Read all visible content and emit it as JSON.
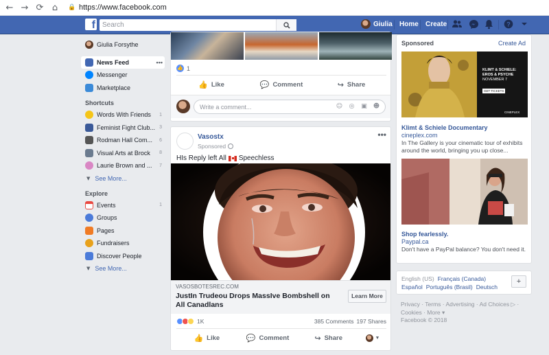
{
  "browser": {
    "back": "←",
    "forward": "→",
    "reload": "⟳",
    "home": "⌂",
    "url": "https://www.facebook.com"
  },
  "topbar": {
    "logo": "f",
    "search_placeholder": "Search",
    "user_name": "Giulia",
    "home": "Home",
    "create": "Create",
    "brand_color": "#4267b2"
  },
  "left_nav": {
    "profile": "Giulia Forsythe",
    "main": [
      {
        "label": "News Feed",
        "icon": "news-feed-icon",
        "color": "#4267b2"
      },
      {
        "label": "Messenger",
        "icon": "messenger-icon",
        "color": "#0084ff"
      },
      {
        "label": "Marketplace",
        "icon": "marketplace-icon",
        "color": "#3b8ad8"
      }
    ],
    "more": "•••",
    "shortcuts_head": "Shortcuts",
    "shortcuts": [
      {
        "label": "Words With Friends",
        "count": "1",
        "color": "#f5c518"
      },
      {
        "label": "Feminist Fight Club...",
        "count": "3",
        "color": "#3a5998"
      },
      {
        "label": "Rodman Hall Com...",
        "count": "6",
        "color": "#555555"
      },
      {
        "label": "Visual Arts at Brock",
        "count": "8",
        "color": "#6b7b8f"
      },
      {
        "label": "Laurie Brown and ...",
        "count": "7",
        "color": "#d987c4"
      }
    ],
    "see_more": "See More...",
    "explore_head": "Explore",
    "explore": [
      {
        "label": "Events",
        "count": "1",
        "color": "#e9473f"
      },
      {
        "label": "Groups",
        "count": "",
        "color": "#4b7bd9"
      },
      {
        "label": "Pages",
        "count": "",
        "color": "#f07b24"
      },
      {
        "label": "Fundraisers",
        "count": "",
        "color": "#e8a11b"
      },
      {
        "label": "Discover People",
        "count": "",
        "color": "#4b7bd9"
      }
    ],
    "see_more2": "See More..."
  },
  "feed": {
    "post1": {
      "like_count": "1",
      "like": "Like",
      "comment": "Comment",
      "share": "Share",
      "comment_placeholder": "Write a comment..."
    },
    "post2": {
      "page_name": "Vasostx",
      "sponsored": "Sponsored",
      "menu": "•••",
      "text_before": "HIs Reply left All",
      "text_after": "Speechless",
      "link_domain": "VASOSBOTESREC.COM",
      "link_title": "JustIn Trudeou Drops MassIve Bombshell on All Canadlans",
      "learn_more": "Learn More",
      "reactions": "1K",
      "comments": "385 Comments",
      "shares": "197 Shares",
      "like": "Like",
      "comment": "Comment",
      "share": "Share"
    }
  },
  "right": {
    "sponsored_head": "Sponsored",
    "create_ad": "Create Ad",
    "ad1": {
      "title": "Klimt & Schiele Documentary",
      "domain": "cineplex.com",
      "desc": "In The Gallery is your cinematic tour of exhibits around the world, bringing you up close...",
      "overlay1": "KLIMT & SCHIELE:",
      "overlay2": "EROS & PSYCHE",
      "overlay3": "NOVEMBER 7",
      "overlay4": "GET TICKETS",
      "overlay5": "CINEPLEX"
    },
    "ad2": {
      "title": "Shop fearlessly.",
      "domain": "Paypal.ca",
      "desc": "Don't have a PayPal balance? You don't need it."
    },
    "languages": {
      "active": "English (US)",
      "l1": "Français (Canada)",
      "l2": "Español",
      "l3": "Português (Brasil)",
      "l4": "Deutsch",
      "add": "+"
    },
    "footer": {
      "line1": "Privacy · Terms · Advertising · Ad Choices ▷ ·",
      "line2": "Cookies · More ▾",
      "line3": "Facebook © 2018"
    }
  }
}
